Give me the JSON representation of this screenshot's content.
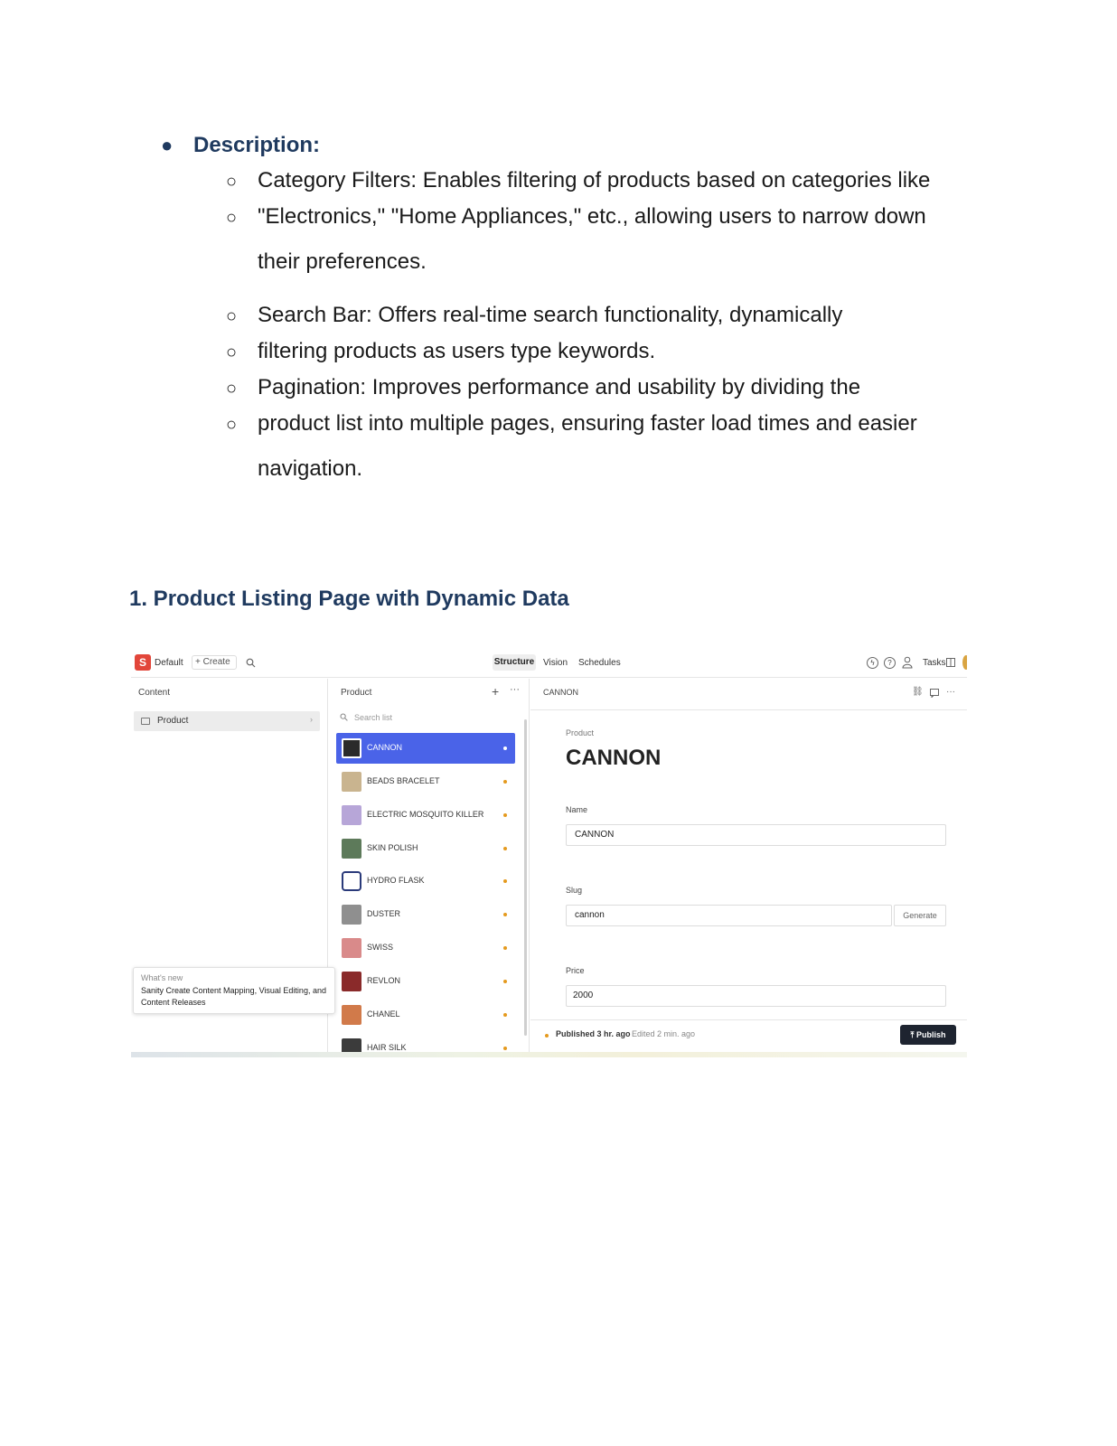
{
  "description": {
    "bullet": "●",
    "heading": "Description:",
    "sub_bullet": "○",
    "lines": [
      "Category Filters: Enables filtering of products based on categories like",
      "\"Electronics,\" \"Home Appliances,\" etc., allowing users to narrow down",
      "their preferences.",
      "Search Bar: Offers real-time search functionality, dynamically",
      "filtering products as users type keywords.",
      "Pagination: Improves performance and usability by dividing the",
      "product list into multiple pages, ensuring faster load times and easier",
      "navigation."
    ]
  },
  "section_heading": "1. Product Listing Page with Dynamic Data",
  "screenshot": {
    "topbar": {
      "logo": "S",
      "workspace": "Default",
      "create": "+ Create",
      "tabs": [
        "Structure",
        "Vision",
        "Schedules"
      ],
      "tasks": "Tasks"
    },
    "left_pane": {
      "title": "Content",
      "item": "Product",
      "whats_new_head": "What's new",
      "whats_new_body": "Sanity Create Content Mapping, Visual Editing, and Content Releases"
    },
    "mid_pane": {
      "title": "Product",
      "search_placeholder": "Search list",
      "products": [
        "CANNON",
        "BEADS BRACELET",
        "ELECTRIC MOSQUITO KILLER",
        "SKIN POLISH",
        "HYDRO FLASK",
        "DUSTER",
        "SWISS",
        "REVLON",
        "CHANEL",
        "HAIR SILK"
      ]
    },
    "right_pane": {
      "header": "CANNON",
      "doc_type": "Product",
      "doc_title": "CANNON",
      "name_label": "Name",
      "name_value": "CANNON",
      "slug_label": "Slug",
      "slug_value": "cannon",
      "generate": "Generate",
      "price_label": "Price",
      "price_value": "2000",
      "published": "Published 3 hr. ago",
      "edited": "Edited 2 min. ago",
      "publish_btn": "Publish"
    }
  },
  "colors": {
    "heading": "#1f3a5f",
    "selected_row": "#4a63e8",
    "logo": "#e2463a",
    "status_dot": "#e59a1e",
    "publish_button": "#1e2430"
  }
}
